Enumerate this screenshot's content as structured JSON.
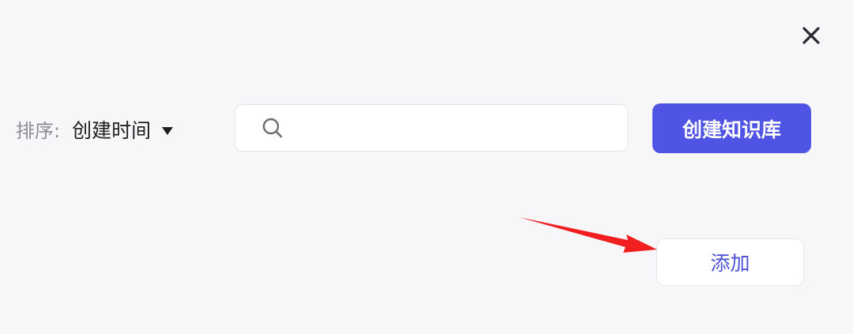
{
  "header": {
    "close_icon": "close-icon"
  },
  "toolbar": {
    "sort_label": "排序:",
    "sort_value": "创建时间",
    "sort_caret_icon": "caret-down-icon",
    "search": {
      "placeholder": "",
      "value": "",
      "icon": "search-icon"
    },
    "create_button_label": "创建知识库"
  },
  "actions": {
    "add_button_label": "添加"
  },
  "annotation": {
    "arrow_color": "#f11f1f"
  },
  "colors": {
    "background": "#f7f7f9",
    "primary": "#5054e4",
    "add_text": "#4b50d6"
  }
}
